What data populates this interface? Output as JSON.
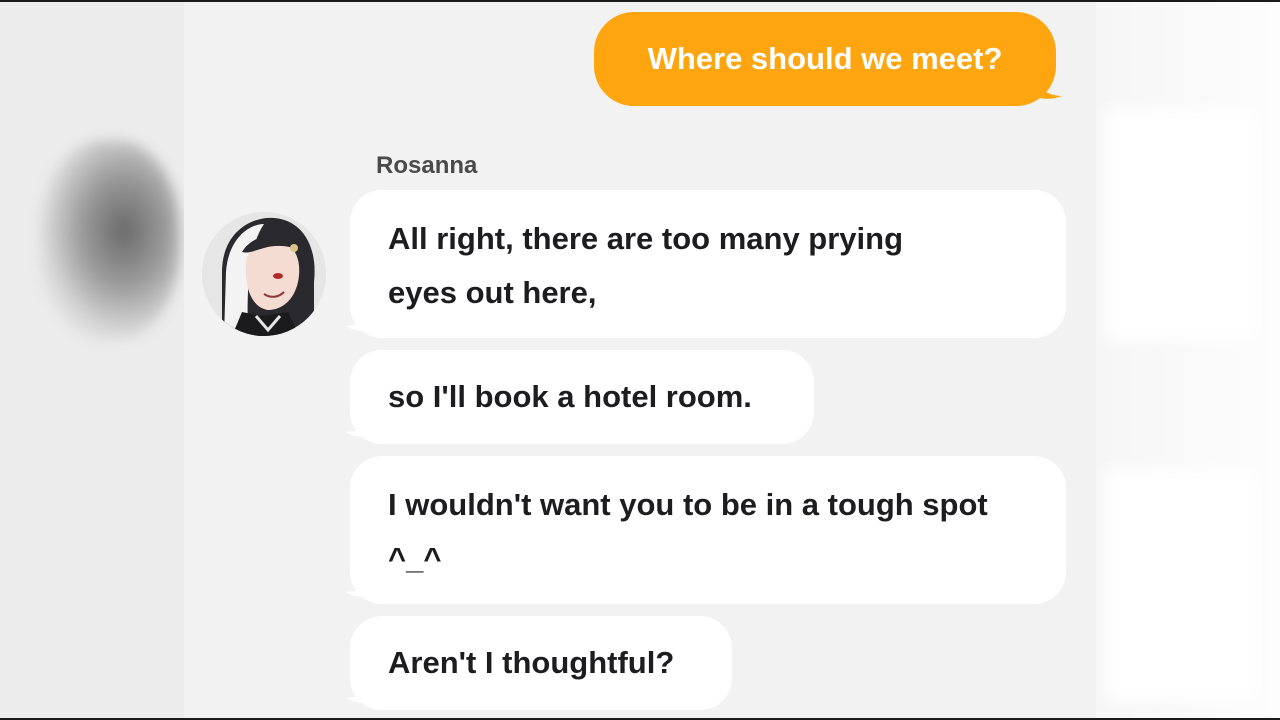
{
  "conversation": {
    "contact_name": "Rosanna",
    "avatar_icon": "character-portrait-icon",
    "sent_messages": [
      {
        "text": "Where should we meet?"
      }
    ],
    "received_messages": [
      {
        "text": "All right, there are too many prying eyes out here,"
      },
      {
        "text": "so I'll book a hotel room."
      },
      {
        "text": "I wouldn't want you to be in a tough spot ^_^"
      },
      {
        "text": "Aren't I thoughtful?"
      }
    ]
  },
  "colors": {
    "sent_bubble": "#ffa50f",
    "received_bubble": "#ffffff",
    "background": "#f2f2f2"
  }
}
